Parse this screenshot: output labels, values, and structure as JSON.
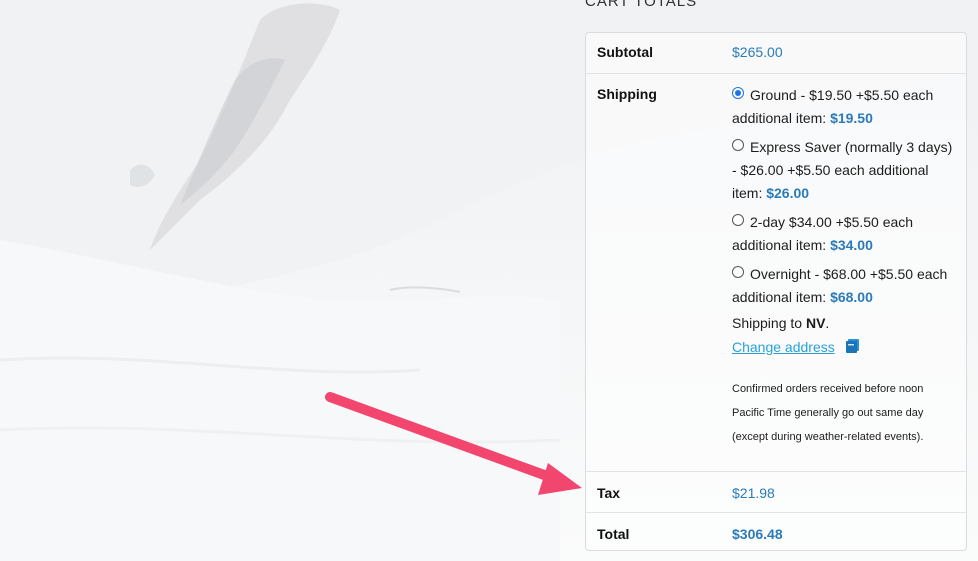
{
  "cart": {
    "heading": "CART TOTALS",
    "subtotal_label": "Subtotal",
    "subtotal_value": "$265.00",
    "shipping_label": "Shipping",
    "shipping_options": [
      {
        "text": "Ground - $19.50 +$5.50 each additional item: ",
        "price": "$19.50",
        "selected": true
      },
      {
        "text": "Express Saver (normally 3 days) - $26.00 +$5.50 each additional item: ",
        "price": "$26.00",
        "selected": false
      },
      {
        "text": "2-day $34.00 +$5.50 each additional item: ",
        "price": "$34.00",
        "selected": false
      },
      {
        "text": "Overnight - $68.00 +$5.50 each additional item: ",
        "price": "$68.00",
        "selected": false
      }
    ],
    "shipping_to_prefix": "Shipping to ",
    "shipping_to_state": "NV",
    "shipping_to_suffix": ".",
    "change_address": "Change address",
    "note": "Confirmed orders received before noon Pacific Time generally go out same day (except during weather-related events).",
    "tax_label": "Tax",
    "tax_value": "$21.98",
    "total_label": "Total",
    "total_value": "$306.48"
  },
  "colors": {
    "link_blue": "#2b7bb9",
    "change_link": "#27a2d8",
    "arrow": "#f2466f",
    "radio_selected": "#1a73e8"
  },
  "icons": {
    "change_address": "address-book-icon"
  }
}
